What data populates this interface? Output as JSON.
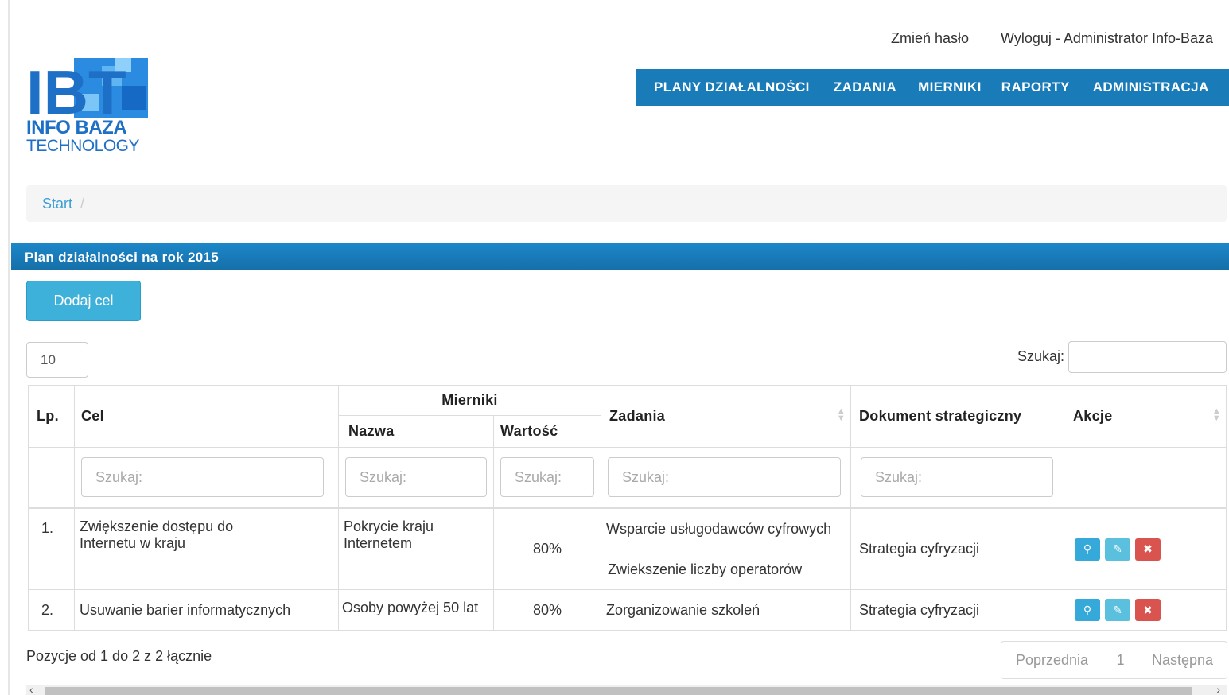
{
  "top_links": {
    "change_password": "Zmień hasło",
    "logout": "Wyloguj - Administrator Info-Baza"
  },
  "logo": {
    "title": "INFO BAZA",
    "subtitle": "TECHNOLOGY"
  },
  "nav": [
    "PLANY DZIAŁALNOŚCI",
    "ZADANIA",
    "MIERNIKI",
    "RAPORTY",
    "ADMINISTRACJA"
  ],
  "breadcrumb": {
    "start": "Start",
    "separator": "/"
  },
  "panel": {
    "title": "Plan działalności na rok 2015"
  },
  "add_button": "Dodaj cel",
  "page_length": "10",
  "search": {
    "label": "Szukaj:"
  },
  "table": {
    "headers": {
      "lp": "Lp.",
      "cel": "Cel",
      "mierniki": "Mierniki",
      "nazwa": "Nazwa",
      "wartosc": "Wartość",
      "zadania": "Zadania",
      "dokument": "Dokument strategiczny",
      "akcje": "Akcje"
    },
    "filter_placeholder": "Szukaj:",
    "rows": [
      {
        "lp": "1.",
        "cel": "Zwiększenie dostępu do Internetu w kraju",
        "nazwa": "Pokrycie kraju Internetem",
        "wartosc": "80%",
        "zadania": [
          "Wsparcie usługodawców cyfrowych",
          "Zwiekszenie liczby operatorów"
        ],
        "dokument": "Strategia cyfryzacji"
      },
      {
        "lp": "2.",
        "cel": "Usuwanie barier informatycznych",
        "nazwa": "Osoby powyżej 50 lat",
        "wartosc": "80%",
        "zadania": [
          "Zorganizowanie szkoleń"
        ],
        "dokument": "Strategia cyfryzacji"
      }
    ]
  },
  "footer": {
    "info": "Pozycje od 1 do 2 z 2 łącznie",
    "prev": "Poprzednia",
    "page": "1",
    "next": "Następna"
  },
  "colors": {
    "nav_bg": "#1a7bb9",
    "panel_bg": "#1d87c9",
    "add_btn": "#3eb1da",
    "delete_btn": "#d9534f"
  },
  "icons": {
    "view": "search-icon",
    "edit": "edit-icon",
    "delete": "close-icon"
  }
}
